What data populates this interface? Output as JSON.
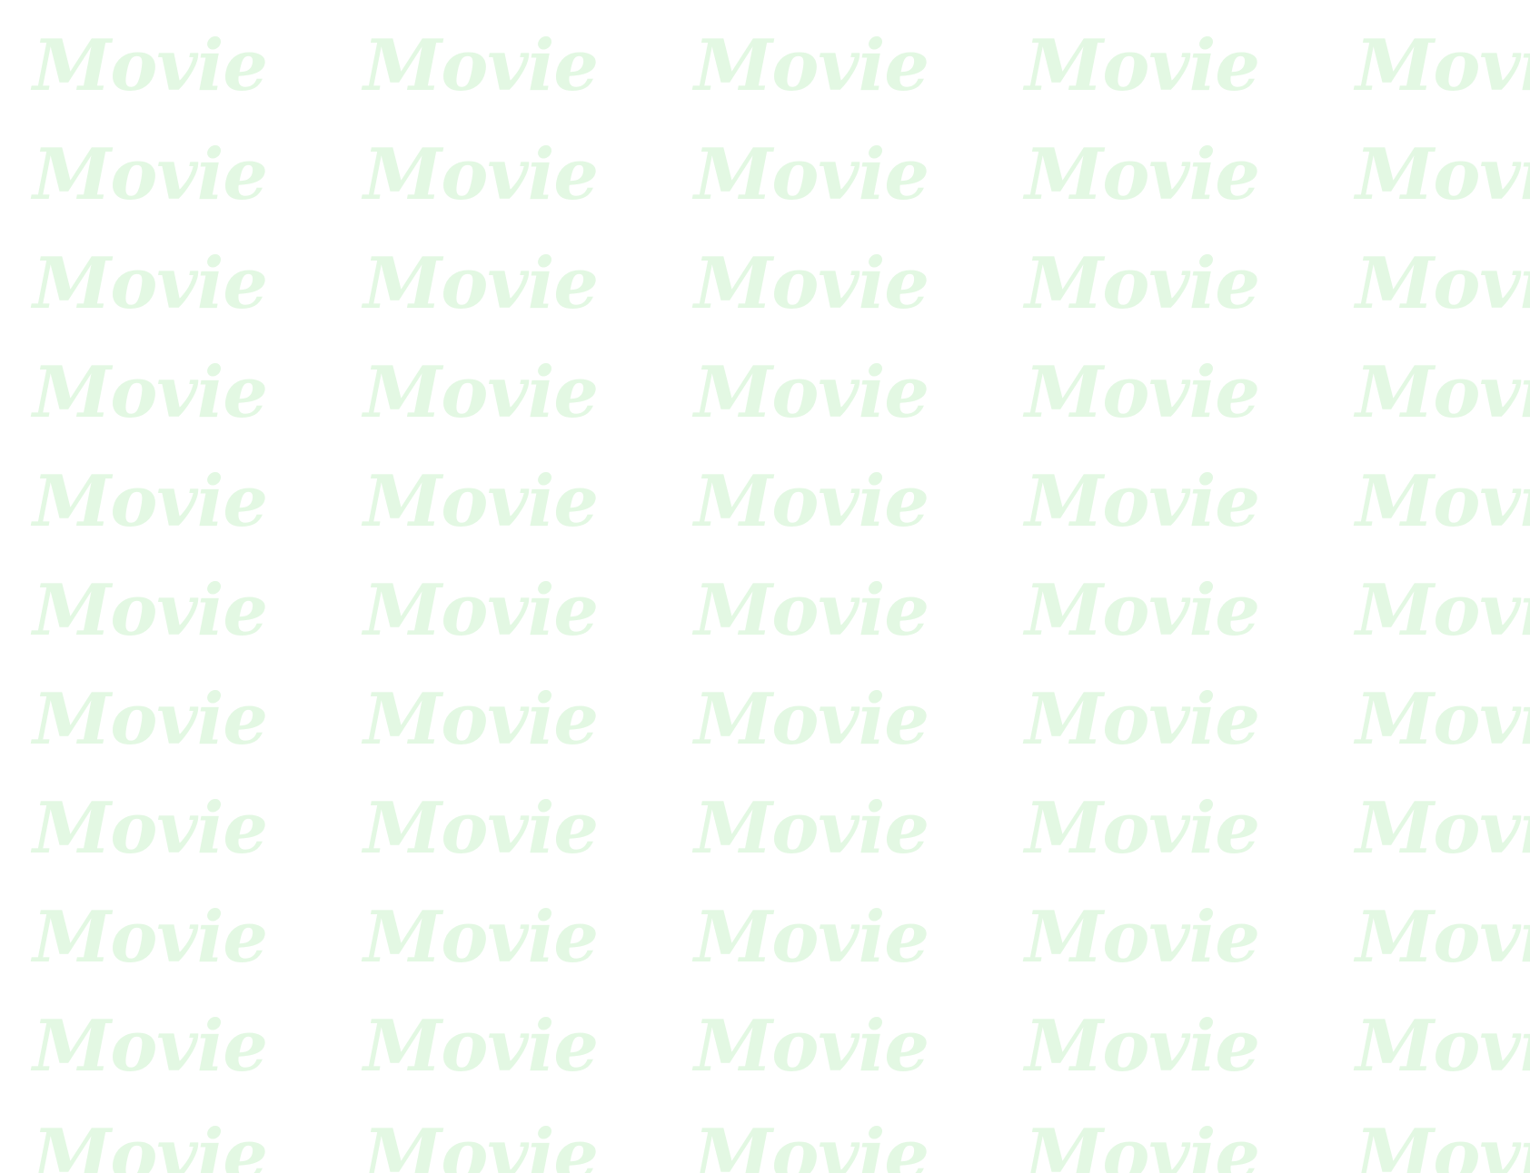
{
  "watermark": {
    "text": "Movie",
    "color": "#e3f8e3"
  }
}
